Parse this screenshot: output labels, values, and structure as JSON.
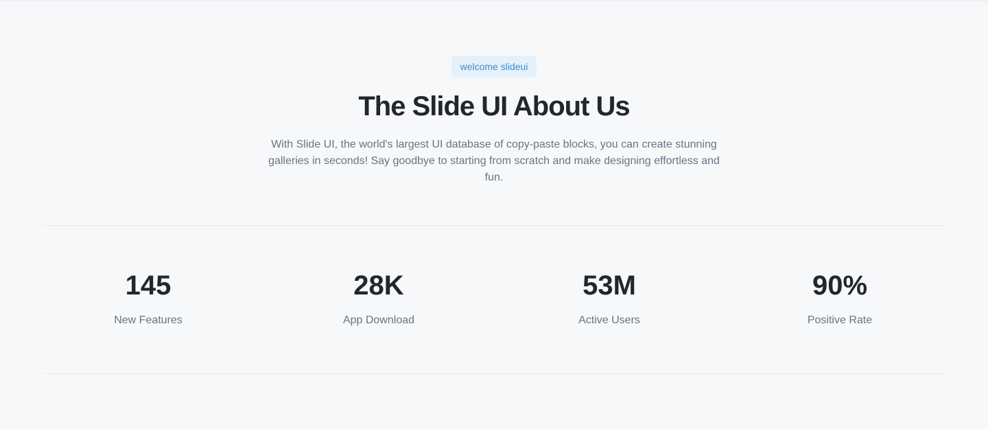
{
  "hero": {
    "badge": "welcome slideui",
    "title": "The Slide UI About Us",
    "description": "With Slide UI, the world's largest UI database of copy-paste blocks, you can create stunning galleries in seconds! Say goodbye to starting from scratch and make designing effortless and fun."
  },
  "stats": [
    {
      "value": "145",
      "label": "New Features"
    },
    {
      "value": "28K",
      "label": "App Download"
    },
    {
      "value": "53M",
      "label": "Active Users"
    },
    {
      "value": "90%",
      "label": "Positive Rate"
    }
  ],
  "colors": {
    "background": "#f7f8fa",
    "badge_bg": "#e4f1fb",
    "badge_text": "#3a8fd1",
    "heading": "#23262b",
    "body_text": "#6b7280",
    "divider": "#e6e8ec"
  }
}
